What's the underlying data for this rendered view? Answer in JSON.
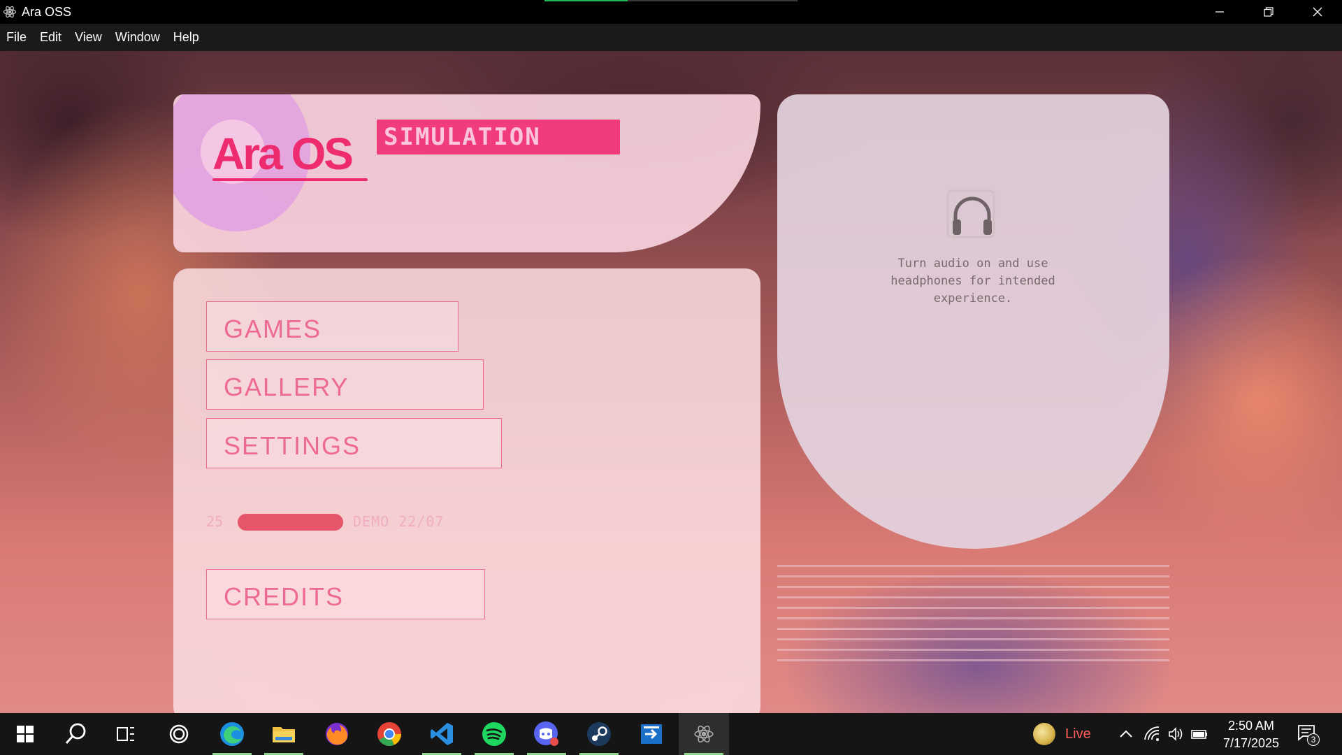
{
  "window": {
    "title": "Ara OSS",
    "media_progress": 0.33,
    "controls": [
      "minimize-icon",
      "restore-icon",
      "close-icon"
    ]
  },
  "menu": {
    "file": "File",
    "edit": "Edit",
    "view": "View",
    "window": "Window",
    "help": "Help"
  },
  "header": {
    "logo": "Ara OS",
    "badge": "SIMULATION"
  },
  "main_menu": {
    "games": "GAMES",
    "gallery": "GALLERY",
    "settings": "SETTINGS",
    "credits": "CREDITS"
  },
  "version": {
    "number": "25",
    "label": "DEMO 22/07"
  },
  "audio_notice": {
    "icon": "headphones-icon",
    "text": "Turn audio on and use headphones for intended experience."
  },
  "taskbar": {
    "apps": [
      "start-icon",
      "search-icon",
      "task-view-icon",
      "cortana-icon",
      "edge-icon",
      "file-explorer-icon",
      "firefox-icon",
      "chrome-icon",
      "vscode-icon",
      "spotify-icon",
      "discord-icon",
      "steam-icon",
      "remote-icon",
      "ara-oss-icon"
    ],
    "live_label": "Live",
    "time": "2:50 AM",
    "date": "7/17/2025",
    "notification_count": "3"
  },
  "colors": {
    "accent_pink": "#ee2b6f",
    "badge_pink": "#f03c7d",
    "button_outline": "#ec6a94",
    "version_bar": "#e5566a"
  }
}
